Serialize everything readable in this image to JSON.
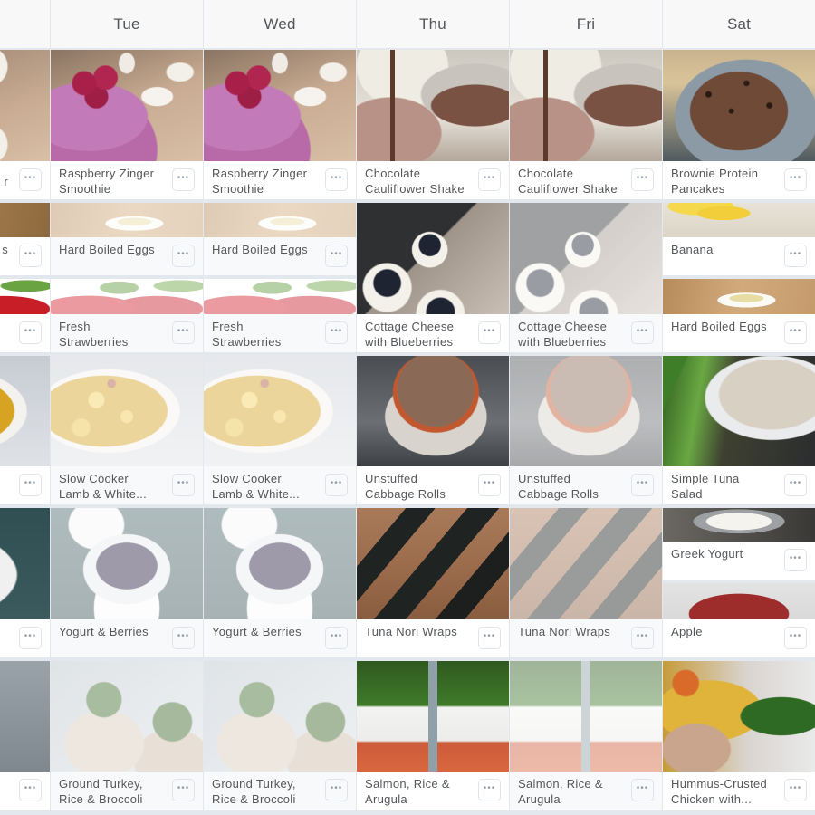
{
  "menu_button_label": "•••",
  "days": [
    {
      "label": "",
      "key": "mon",
      "cells": [
        {
          "name": "",
          "image": "f-mon-breakfast",
          "leftover": false
        },
        {
          "name": "",
          "image": "f-mon-snack1",
          "leftover": false
        },
        {
          "name": "",
          "image": "f-strawberry",
          "leftover": false
        },
        {
          "name": "",
          "image": "f-stew",
          "leftover": false
        },
        {
          "name": "",
          "image": "f-mon-yogurt",
          "leftover": false
        },
        {
          "name": "",
          "image": "f-mon-dinner",
          "leftover": false
        }
      ],
      "partial_labels": [
        "r",
        "s",
        "",
        "",
        "",
        ""
      ]
    },
    {
      "label": "Tue",
      "key": "tue",
      "cells": [
        {
          "name": "Raspberry Zinger Smoothie",
          "image": "f-smoothie",
          "leftover": false
        },
        {
          "name": "Hard Boiled Eggs",
          "image": "f-egg",
          "leftover": true
        },
        {
          "name": "Fresh Strawberries",
          "image": "f-strawberry",
          "leftover": true
        },
        {
          "name": "Slow Cooker Lamb & White...",
          "image": "f-stew",
          "leftover": true
        },
        {
          "name": "Yogurt & Berries",
          "image": "f-yogurt-berries",
          "leftover": true
        },
        {
          "name": "Ground Turkey, Rice & Broccoli",
          "image": "f-turkey",
          "leftover": true
        }
      ]
    },
    {
      "label": "Wed",
      "key": "wed",
      "cells": [
        {
          "name": "Raspberry Zinger Smoothie",
          "image": "f-smoothie",
          "leftover": false
        },
        {
          "name": "Hard Boiled Eggs",
          "image": "f-egg",
          "leftover": true
        },
        {
          "name": "Fresh Strawberries",
          "image": "f-strawberry",
          "leftover": true
        },
        {
          "name": "Slow Cooker Lamb & White...",
          "image": "f-stew",
          "leftover": true
        },
        {
          "name": "Yogurt & Berries",
          "image": "f-yogurt-berries",
          "leftover": true
        },
        {
          "name": "Ground Turkey, Rice & Broccoli",
          "image": "f-turkey",
          "leftover": true
        }
      ]
    },
    {
      "label": "Thu",
      "key": "thu",
      "cells": [
        {
          "name": "Chocolate Cauliflower Shake",
          "image": "f-shake",
          "leftover": false
        },
        {
          "name": "Cottage Cheese with Blueberries",
          "image": "f-cottage",
          "leftover": false
        },
        {
          "name": "Unstuffed Cabbage Rolls",
          "image": "f-cabbage",
          "leftover": false
        },
        {
          "name": "Tuna Nori Wraps",
          "image": "f-nori",
          "leftover": false
        },
        {
          "name": "Salmon, Rice & Arugula",
          "image": "f-salmon",
          "leftover": false
        }
      ]
    },
    {
      "label": "Fri",
      "key": "fri",
      "cells": [
        {
          "name": "Chocolate Cauliflower Shake",
          "image": "f-shake",
          "leftover": false
        },
        {
          "name": "Cottage Cheese with Blueberries",
          "image": "f-cottage",
          "leftover": true
        },
        {
          "name": "Unstuffed Cabbage Rolls",
          "image": "f-cabbage",
          "leftover": true
        },
        {
          "name": "Tuna Nori Wraps",
          "image": "f-nori",
          "leftover": true
        },
        {
          "name": "Salmon, Rice & Arugula",
          "image": "f-salmon",
          "leftover": true
        }
      ]
    },
    {
      "label": "Sat",
      "key": "sat",
      "cells": [
        {
          "name": "Brownie Protein Pancakes",
          "image": "f-pancake",
          "leftover": false
        },
        {
          "name": "Banana",
          "image": "f-banana",
          "leftover": false
        },
        {
          "name": "Hard Boiled Eggs",
          "image": "f-egg",
          "leftover": false
        },
        {
          "name": "Simple Tuna Salad",
          "image": "f-tuna",
          "leftover": false
        },
        {
          "name": "Greek Yogurt",
          "image": "f-greek",
          "leftover": false
        },
        {
          "name": "Apple",
          "image": "f-apple",
          "leftover": false
        },
        {
          "name": "Hummus-Crusted Chicken with...",
          "image": "f-hummus",
          "leftover": false
        }
      ]
    }
  ]
}
